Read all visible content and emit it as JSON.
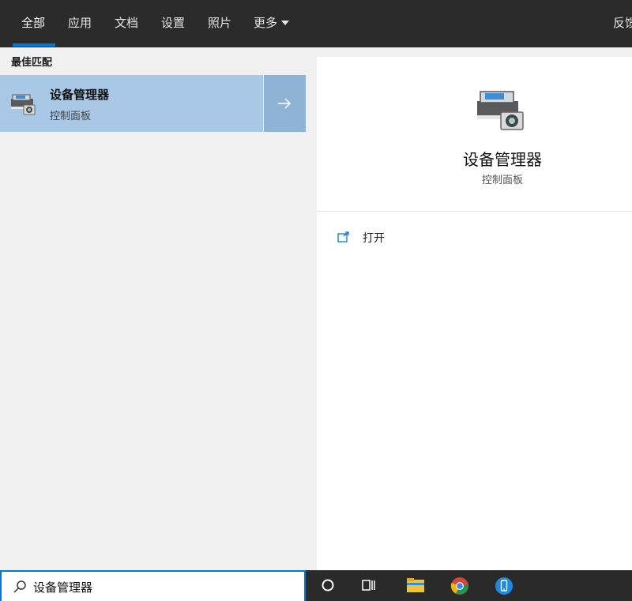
{
  "tabs": [
    {
      "label": "全部",
      "active": true
    },
    {
      "label": "应用"
    },
    {
      "label": "文档"
    },
    {
      "label": "设置"
    },
    {
      "label": "照片"
    },
    {
      "label": "更多"
    }
  ],
  "feedback_label": "反馈",
  "best_match": {
    "section_title": "最佳匹配",
    "title": "设备管理器",
    "subtitle": "控制面板",
    "arrow_icon": "arrow-right-icon"
  },
  "details": {
    "title": "设备管理器",
    "subtitle": "控制面板",
    "action_open": "打开"
  },
  "search": {
    "value": "设备管理器"
  },
  "taskbar_icons": [
    "cortana-circle-icon",
    "task-view-icon",
    "file-explorer-icon",
    "chrome-icon",
    "phone-icon"
  ],
  "colors": {
    "accent": "#0078d7",
    "selection": "#a9c8e6",
    "topbar": "#2b2b2b"
  }
}
